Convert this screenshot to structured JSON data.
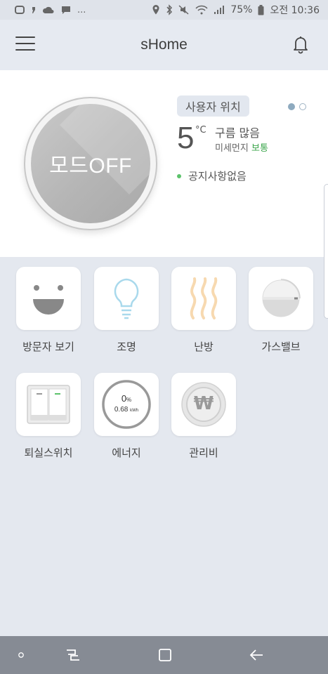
{
  "status_bar": {
    "more": "...",
    "battery_percent": "75%",
    "time": "오전 10:36"
  },
  "app_bar": {
    "title": "sHome"
  },
  "mode": {
    "label": "모드OFF"
  },
  "weather": {
    "location": "사용자 위치",
    "temperature": "5",
    "unit": "°C",
    "condition": "구름 많음",
    "dust_label": "미세먼지",
    "dust_value": "보통",
    "dust_color": "#3aa54a"
  },
  "notice": {
    "text": "공지사항없음"
  },
  "energy": {
    "percent": "0",
    "percent_unit": "%",
    "usage": "0.68",
    "usage_unit": "kWh"
  },
  "bill": {
    "symbol": "₩"
  },
  "grid": [
    {
      "label": "방문자 보기"
    },
    {
      "label": "조명"
    },
    {
      "label": "난방"
    },
    {
      "label": "가스밸브"
    },
    {
      "label": "퇴실스위치"
    },
    {
      "label": "에너지"
    },
    {
      "label": "관리비"
    }
  ]
}
